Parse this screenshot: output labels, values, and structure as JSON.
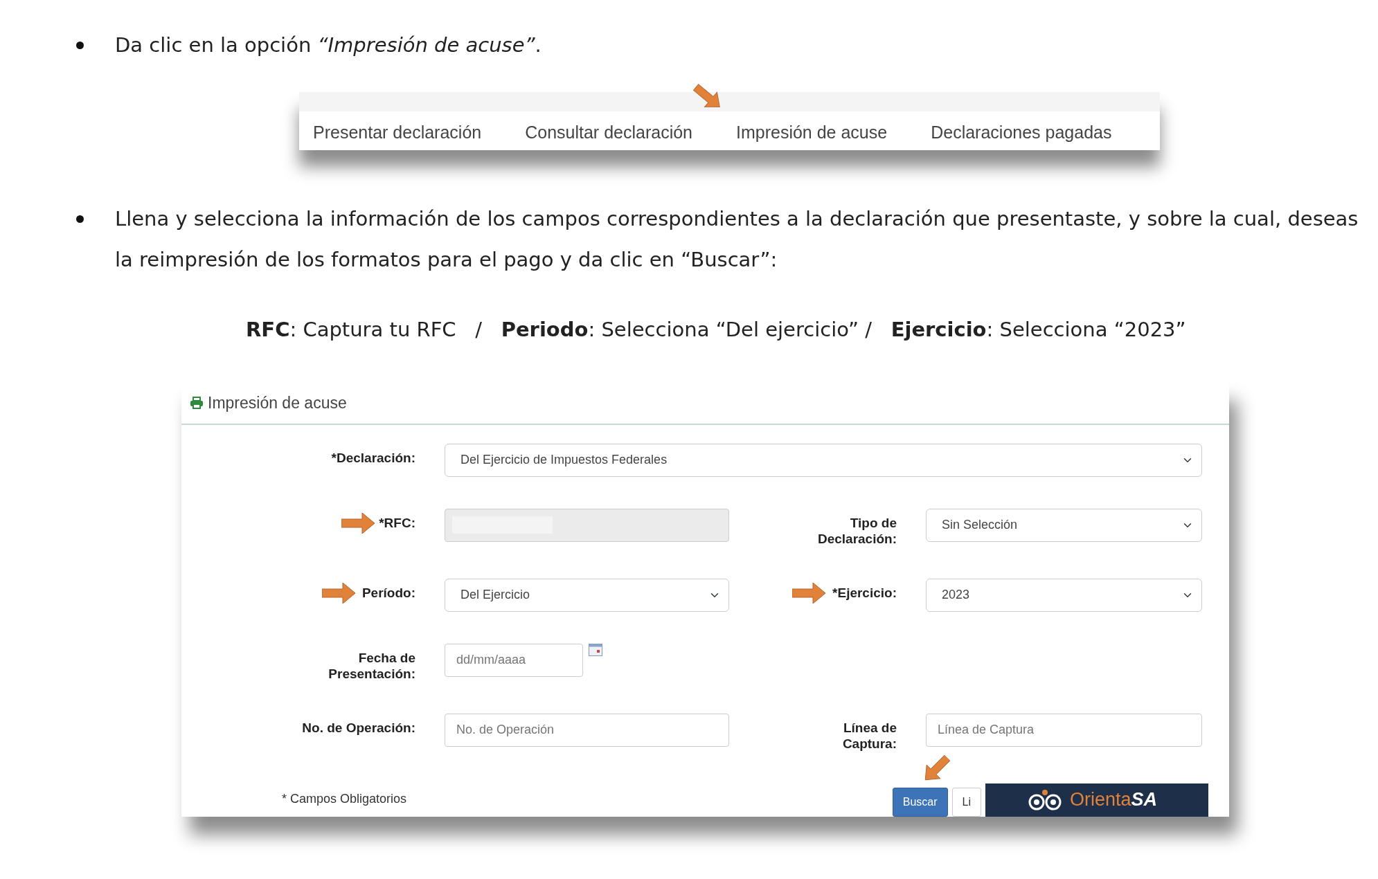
{
  "steps": [
    {
      "text": "Da clic en la opción *“Impresión de acuse”*."
    },
    {
      "text": "Llena y selecciona la información de los campos correspondientes a la declaración que presentaste, y sobre la cual, deseas la reimpresión de los formatos para el pago y da clic en “Buscar”:"
    }
  ],
  "menu": {
    "items": [
      {
        "label": "Presentar declaración",
        "arrow": false
      },
      {
        "label": "Consultar declaración",
        "arrow": false
      },
      {
        "label": "Impresión de acuse",
        "arrow": true
      },
      {
        "label": "Declaraciones pagadas",
        "arrow": false
      }
    ]
  },
  "criteria": "**RFC**: Captura tu RFC   /   **Periodo**: Selecciona “Del ejercicio” /   **Ejercicio**: Selecciona “2023”",
  "form": {
    "title": "Impresión de acuse",
    "rows": [
      [
        {
          "label": "*Declaración:",
          "kind": "select",
          "value": "Del Ejercicio de Impuestos Federales",
          "wide": true,
          "arrow": false
        }
      ],
      [
        {
          "label": "*RFC:",
          "kind": "text",
          "disabled": true,
          "arrow": true
        },
        {
          "label": "Tipo de Declaración:",
          "kind": "select",
          "value": "Sin Selección",
          "arrow": false
        }
      ],
      [
        {
          "label": "Período:",
          "kind": "select",
          "value": "Del Ejercicio",
          "arrow": true
        },
        {
          "label": "*Ejercicio:",
          "kind": "select",
          "value": "2023",
          "arrow": true
        }
      ],
      [
        {
          "label": "Fecha de Presentación:",
          "kind": "date",
          "placeholder": "dd/mm/aaaa",
          "arrow": false
        }
      ],
      [
        {
          "label": "No. de Operación:",
          "kind": "text",
          "placeholder": "No. de Operación",
          "disabled": false,
          "arrow": false
        },
        {
          "label": "Línea de Captura:",
          "kind": "text",
          "placeholder": "Línea de Captura",
          "disabled": false,
          "arrow": false
        }
      ]
    ],
    "note": "* Campos Obligatorios",
    "buttons": [
      {
        "label": "Buscar",
        "kind": "primary",
        "arrow": true
      },
      {
        "label": "Li",
        "kind": "secondary",
        "arrow": false
      }
    ],
    "banner": {
      "brand": "Orienta",
      "brand_bold": "SA"
    }
  }
}
